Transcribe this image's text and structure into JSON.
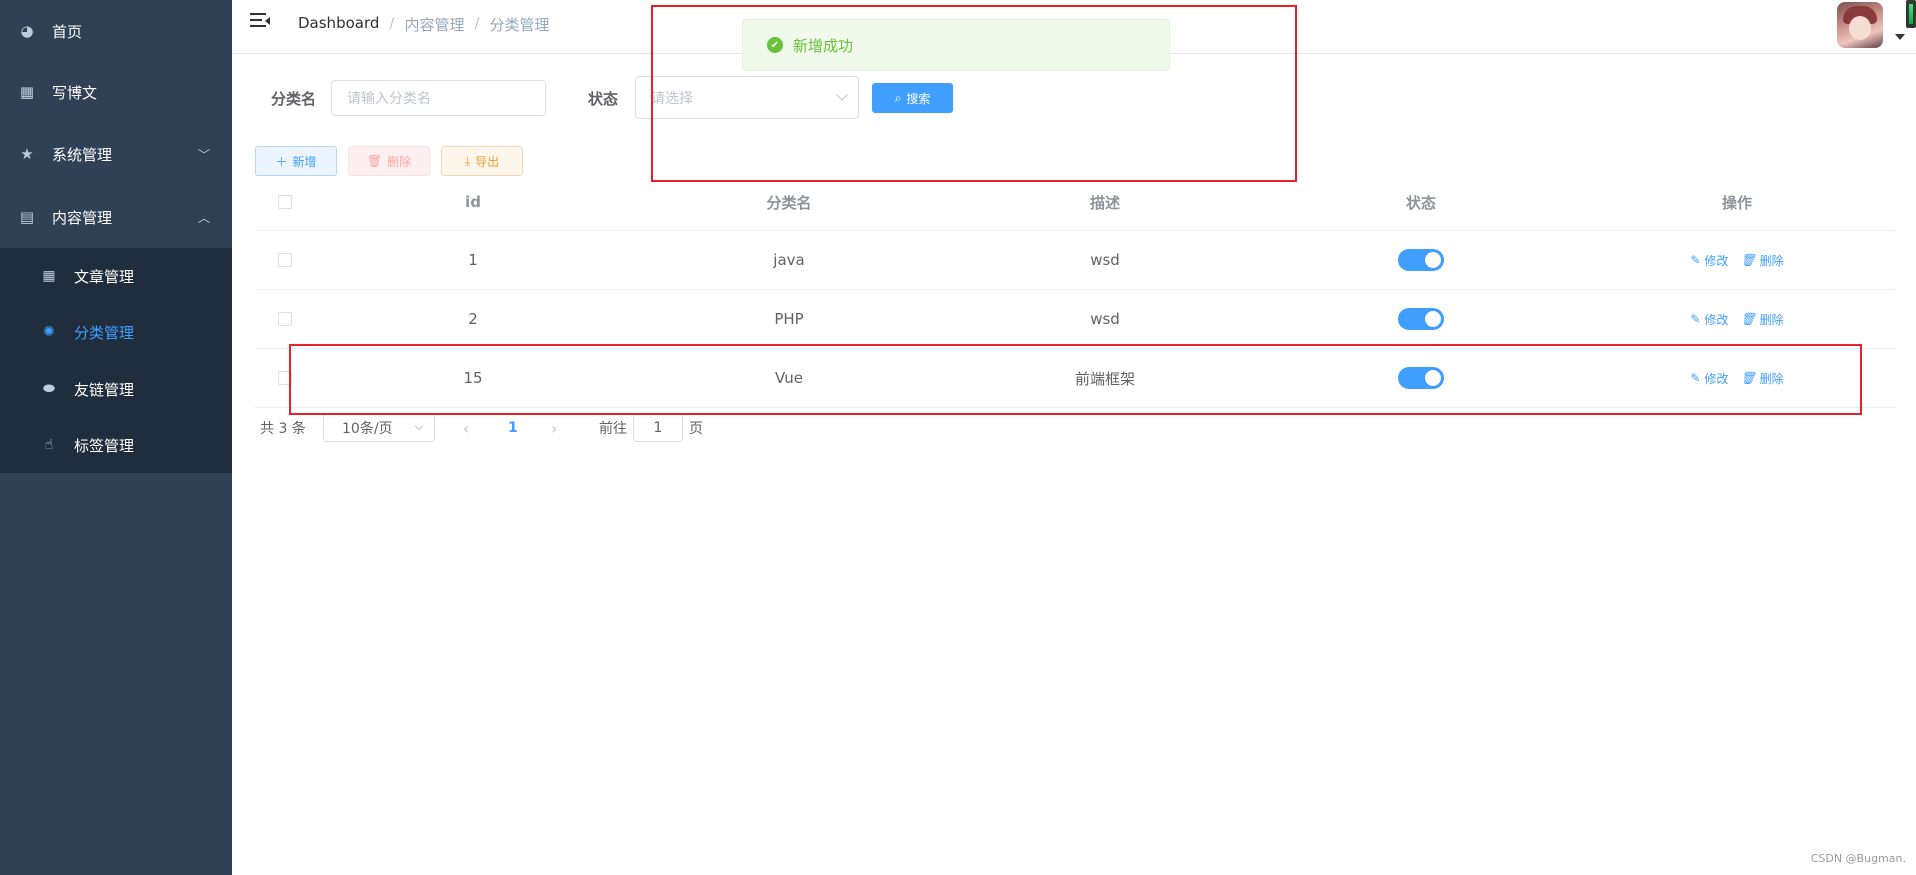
{
  "sidebar": {
    "items": [
      {
        "label": "首页",
        "icon": "dashboard-icon"
      },
      {
        "label": "写博文",
        "icon": "table-icon"
      },
      {
        "label": "系统管理",
        "icon": "star-icon"
      },
      {
        "label": "内容管理",
        "icon": "grid-icon"
      }
    ],
    "subitems": [
      {
        "label": "文章管理",
        "icon": "table-icon"
      },
      {
        "label": "分类管理",
        "icon": "category-icon"
      },
      {
        "label": "友链管理",
        "icon": "link-icon"
      },
      {
        "label": "标签管理",
        "icon": "hand-icon"
      }
    ]
  },
  "navbar": {
    "breadcrumb": [
      "Dashboard",
      "内容管理",
      "分类管理"
    ],
    "separator": "/"
  },
  "search": {
    "name_label": "分类名",
    "name_placeholder": "请输入分类名",
    "status_label": "状态",
    "status_placeholder": "请选择",
    "search_label": "搜索"
  },
  "toolbar": {
    "add_label": "新增",
    "delete_label": "删除",
    "export_label": "导出"
  },
  "table": {
    "columns": [
      "id",
      "分类名",
      "描述",
      "状态",
      "操作"
    ],
    "rows": [
      {
        "id": "1",
        "name": "java",
        "desc": "wsd",
        "status": true
      },
      {
        "id": "2",
        "name": "PHP",
        "desc": "wsd",
        "status": true
      },
      {
        "id": "15",
        "name": "Vue",
        "desc": "前端框架",
        "status": true
      }
    ],
    "edit_label": "修改",
    "delete_label": "删除"
  },
  "pagination": {
    "total": "共 3 条",
    "page_size": "10条/页",
    "current": "1",
    "goto_label": "前往",
    "goto_value": "1",
    "page_suffix": "页"
  },
  "toast": {
    "message": "新增成功",
    "color": "#67c23a"
  },
  "theme": {
    "primary": "#409eff",
    "sidebar_bg": "#304156"
  },
  "watermark": "CSDN @Bugman."
}
